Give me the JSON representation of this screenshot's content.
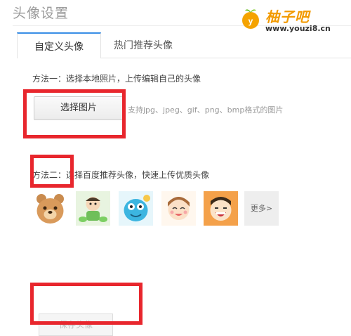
{
  "header": {
    "title": "头像设置"
  },
  "watermark": {
    "name": "柚子吧",
    "url": "www.youzi8.cn"
  },
  "tabs": [
    {
      "label": "自定义头像",
      "active": true
    },
    {
      "label": "热门推荐头像",
      "active": false
    }
  ],
  "method1": {
    "label": "方法一：选择本地照片，上传编辑自己的头像",
    "button_label": "选择图片",
    "support_text": "支持jpg、jpeg、gif、png、bmp格式的图片"
  },
  "method2": {
    "label": "方法二：选择百度推荐头像，快速上传优质头像",
    "avatars": [
      "bear",
      "frog-boy",
      "blue-creature",
      "smiling-girl",
      "laughing-boy"
    ],
    "more_label": "更多>"
  },
  "save_button_label": "保存头像",
  "colors": {
    "accent": "#3a8ee6",
    "highlight": "#e8262d",
    "brand": "#f29a00"
  }
}
